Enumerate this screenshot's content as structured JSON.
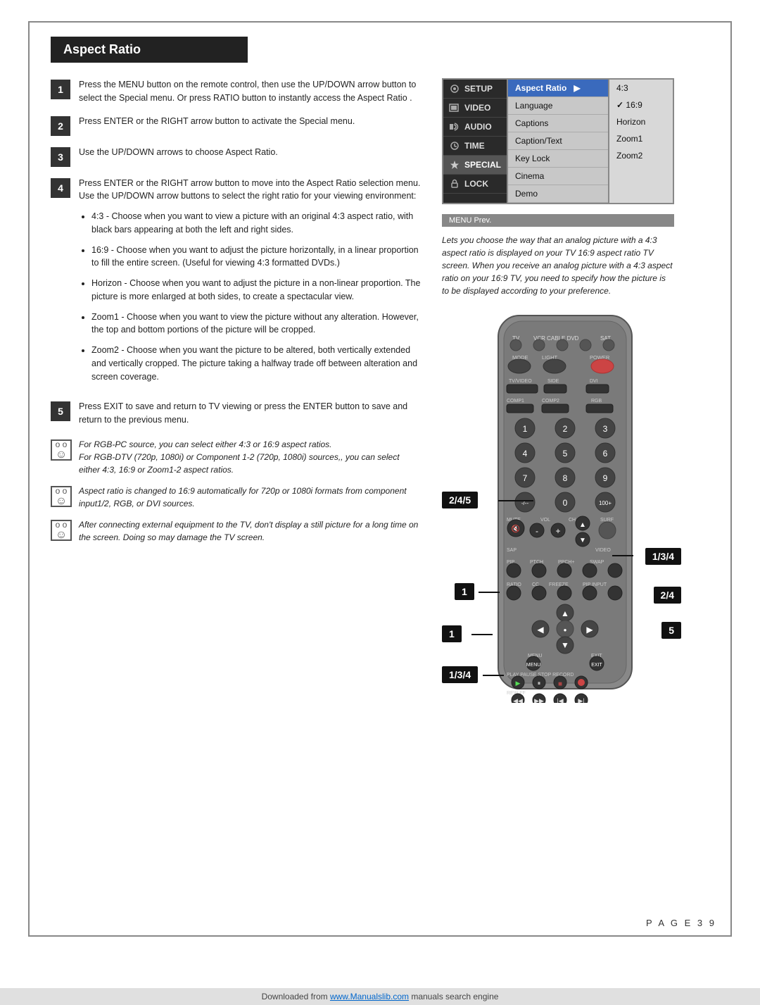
{
  "page": {
    "title": "Aspect Ratio",
    "page_number": "P A G E   3 9"
  },
  "steps": [
    {
      "number": "1",
      "text": "Press the MENU button on the remote control, then use the UP/DOWN arrow button to select the Special menu. Or press RATIO button to instantly access the Aspect Ratio ."
    },
    {
      "number": "2",
      "text": "Press ENTER or the RIGHT arrow button to activate the Special menu."
    },
    {
      "number": "3",
      "text": "Use the UP/DOWN arrows to choose Aspect Ratio."
    },
    {
      "number": "4",
      "text": "Press ENTER or the RIGHT arrow button to move into the Aspect Ratio selection menu. Use the UP/DOWN arrow buttons to select the right ratio for your viewing environment:"
    },
    {
      "number": "5",
      "text": "Press EXIT to save and return to TV viewing or press the ENTER button to save and return to the previous menu."
    }
  ],
  "bullets": [
    {
      "text": "4:3 - Choose when you want to view a picture with an original 4:3 aspect ratio, with black bars appearing at both the left and right sides."
    },
    {
      "text": "16:9 - Choose when you want to adjust the picture horizontally, in a linear proportion to fill the entire screen. (Useful for viewing 4:3 formatted DVDs.)"
    },
    {
      "text": "Horizon - Choose when you want to adjust the picture in a non-linear proportion. The picture is more enlarged at both sides, to create a spectacular view."
    },
    {
      "text": "Zoom1 - Choose when you want to view the picture without any alteration. However, the top and bottom portions of the picture will be cropped."
    },
    {
      "text": "Zoom2 - Choose when you want the picture to be altered, both vertically extended and vertically cropped. The picture taking a halfway trade off between alteration and screen coverage."
    }
  ],
  "notes": [
    {
      "text": "For RGB-PC source, you can select either 4:3 or 16:9 aspect ratios.\nFor RGB-DTV (720p, 1080i) or Component 1-2 (720p, 1080i) sources,, you can select either 4:3, 16:9 or Zoom1-2 aspect ratios."
    },
    {
      "text": "Aspect ratio is changed to 16:9 automatically for 720p or 1080i formats from component input1/2, RGB, or DVI sources."
    },
    {
      "text": "After connecting external equipment to the TV, don't display a still picture for a long time on the screen. Doing so may damage the TV screen."
    }
  ],
  "tv_menu": {
    "left_items": [
      "SETUP",
      "VIDEO",
      "AUDIO",
      "TIME",
      "SPECIAL",
      "LOCK"
    ],
    "active_item": "SPECIAL",
    "middle_items": [
      "Aspect Ratio",
      "Language",
      "Captions",
      "Caption/Text",
      "Key Lock",
      "Cinema",
      "Demo"
    ],
    "highlighted_item": "Aspect Ratio",
    "right_items": [
      "4:3",
      "16:9",
      "Horizon",
      "Zoom1",
      "Zoom2"
    ],
    "checked_item": "16:9",
    "bottom_bar": "MENU  Prev.",
    "arrow_label": "▶"
  },
  "menu_caption": "Lets you choose the way that an analog picture with a 4:3 aspect ratio is displayed on your TV 16:9 aspect ratio TV screen. When you receive an analog picture with a 4:3 aspect ratio on your 16:9 TV, you need to specify how the picture is to be displayed according to your preference.",
  "callouts": {
    "label_245": "2/4/5",
    "label_1_top": "1",
    "label_134_right": "1/3/4",
    "label_24_right": "2/4",
    "label_5_right": "5",
    "label_1_bot": "1",
    "label_134_bot": "1/3/4"
  },
  "footer": {
    "text": "Downloaded from ",
    "link_text": "www.Manualslib.com",
    "text2": " manuals search engine"
  }
}
